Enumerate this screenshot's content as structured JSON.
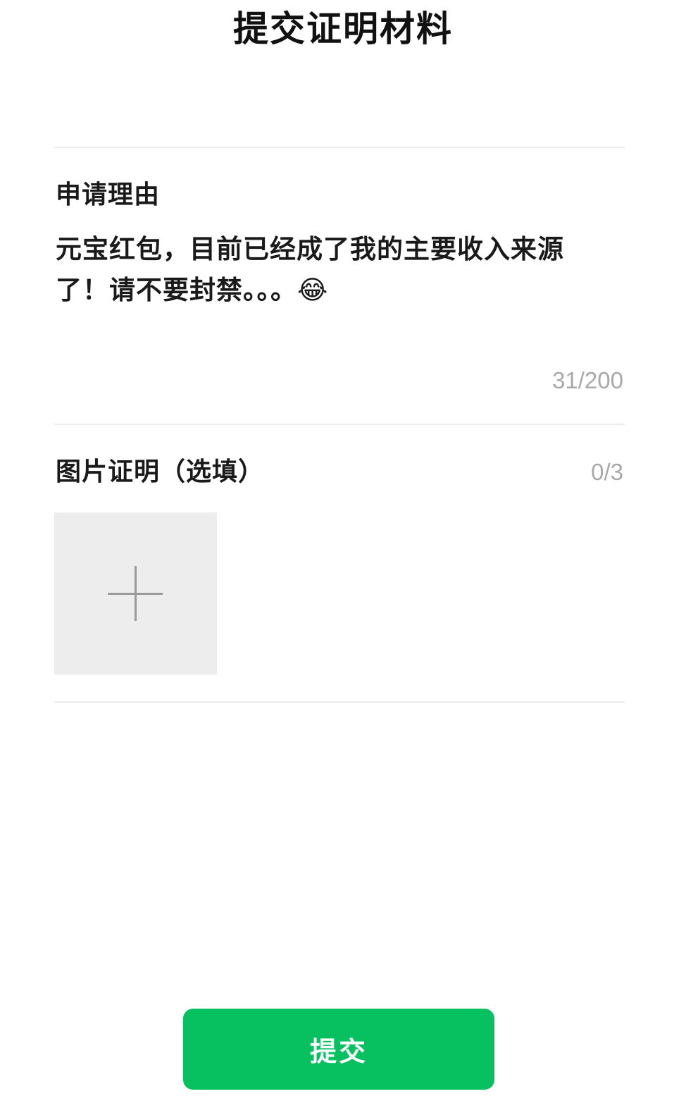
{
  "header": {
    "title": "提交证明材料"
  },
  "reason": {
    "label": "申请理由",
    "text": "元宝红包，目前已经成了我的主要收入来源了！请不要封禁。。。😂",
    "counter": "31/200"
  },
  "photos": {
    "label": "图片证明（选填）",
    "counter": "0/3",
    "add_icon": "plus-icon"
  },
  "actions": {
    "submit_label": "提交"
  },
  "colors": {
    "accent": "#07c160",
    "muted_text": "#a8a8a8",
    "placeholder_bg": "#ededed",
    "divider": "#ececec"
  }
}
